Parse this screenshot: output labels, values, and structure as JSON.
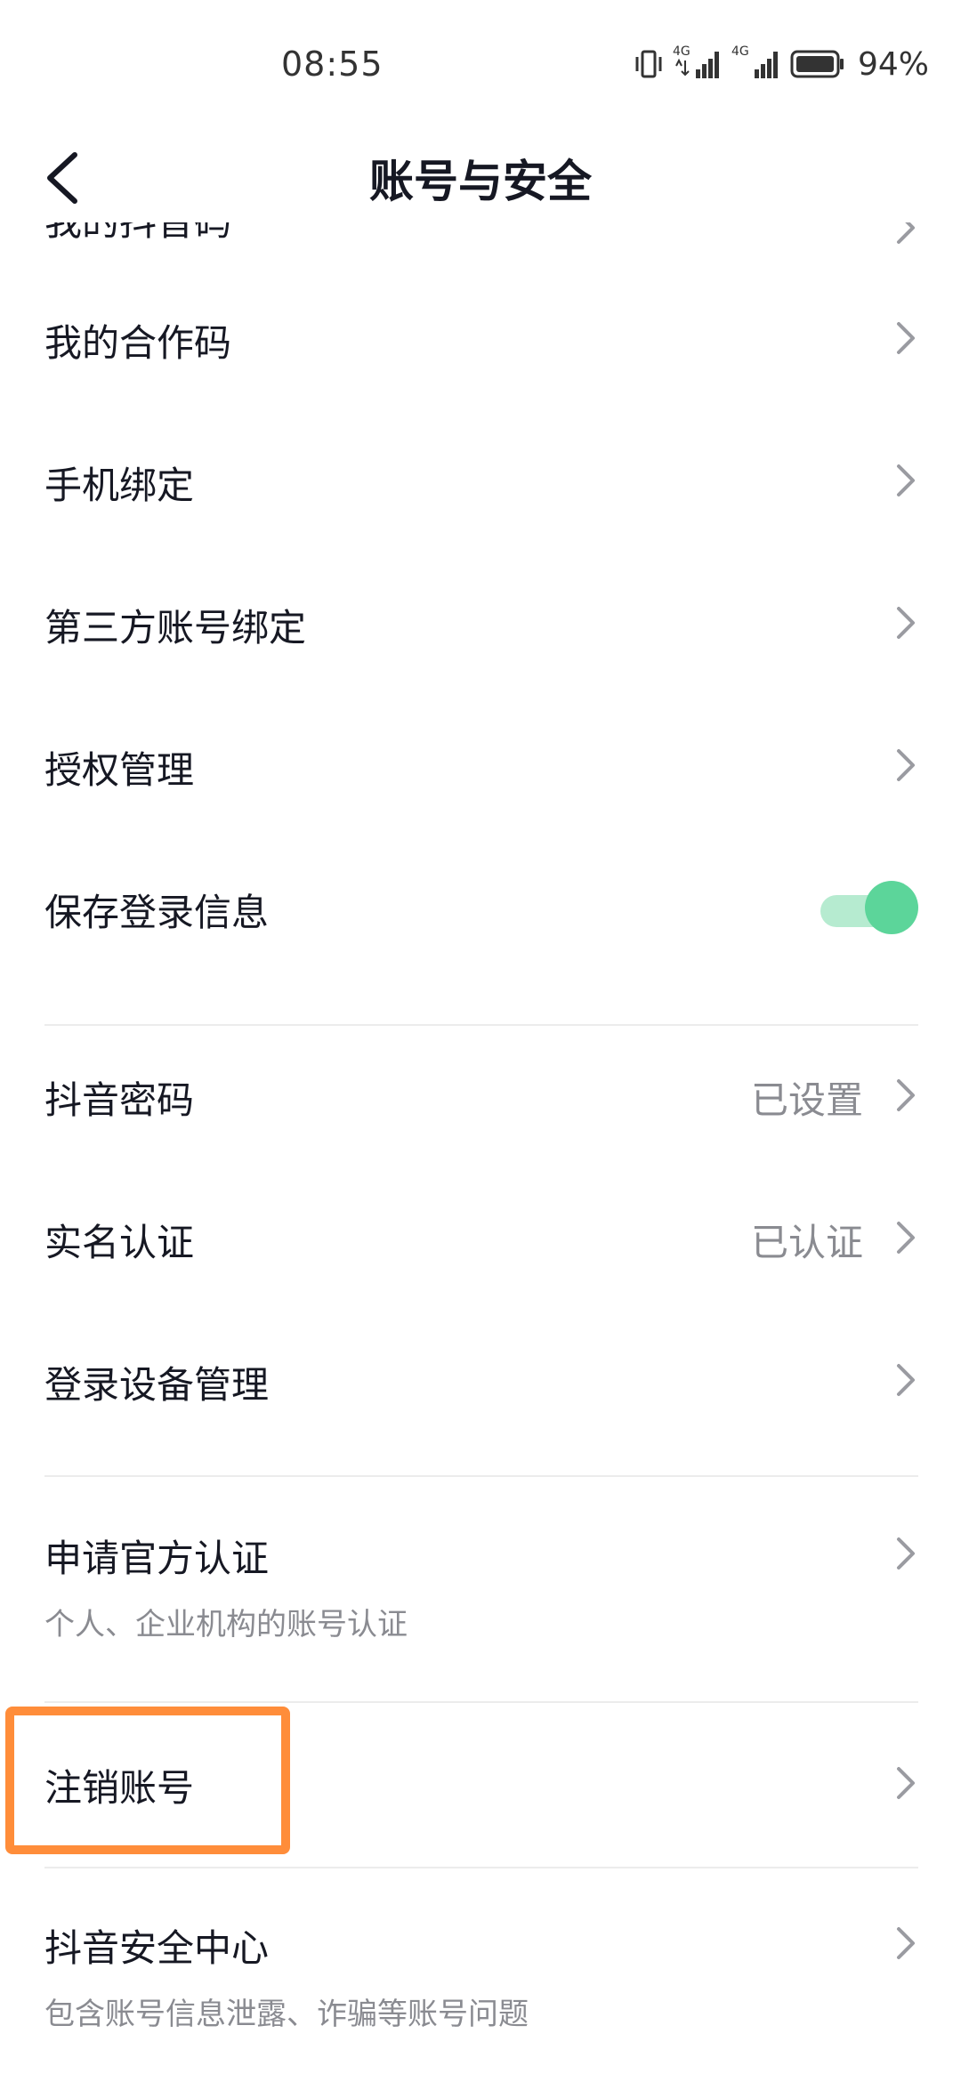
{
  "status_bar": {
    "time": "08:55",
    "network_1": "4G",
    "network_2": "4G",
    "battery": "94%"
  },
  "header": {
    "title": "账号与安全"
  },
  "list": {
    "partial_item": "我的抖音码",
    "items": [
      {
        "label": "我的合作码"
      },
      {
        "label": "手机绑定"
      },
      {
        "label": "第三方账号绑定"
      },
      {
        "label": "授权管理"
      },
      {
        "label": "保存登录信息",
        "toggle_on": true
      },
      {
        "label": "抖音密码",
        "value": "已设置"
      },
      {
        "label": "实名认证",
        "value": "已认证"
      },
      {
        "label": "登录设备管理"
      },
      {
        "label": "申请官方认证",
        "sub": "个人、企业机构的账号认证"
      },
      {
        "label": "注销账号"
      },
      {
        "label": "抖音安全中心",
        "sub": "包含账号信息泄露、诈骗等账号问题"
      }
    ]
  },
  "colors": {
    "toggle_on": "#5cd59a",
    "highlight": "#ff8d3a",
    "text_primary": "#161823",
    "text_secondary": "#8a8b91"
  },
  "icons": [
    "back-icon",
    "chevron-right-icon",
    "vibrate-icon",
    "signal-icon",
    "battery-icon"
  ]
}
